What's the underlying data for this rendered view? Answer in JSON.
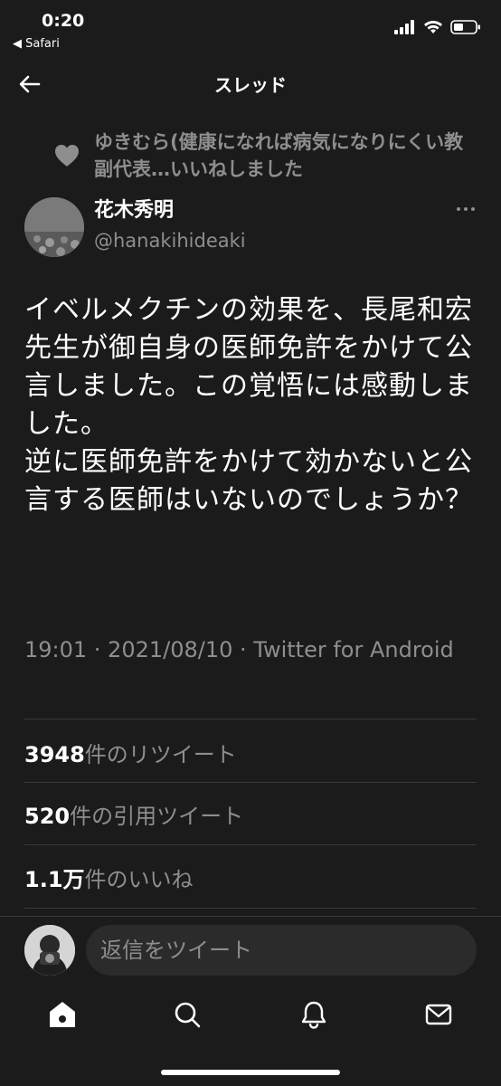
{
  "status_bar": {
    "time": "0:20",
    "back_app": "◀ Safari"
  },
  "header": {
    "title": "スレッド"
  },
  "social_context": {
    "text": "ゆきむら(健康になれば病気になりにくい教副代表…いいねしました"
  },
  "author": {
    "name": "花木秀明",
    "handle": "@hanakihideaki"
  },
  "tweet": {
    "text": "イベルメクチンの効果を、長尾和宏先生が御自身の医師免許をかけて公言しました。この覚悟には感動しました。\n逆に医師免許をかけて効かないと公言する医師はいないのでしょうか？",
    "meta": "19:01 · 2021/08/10 · Twitter for Android"
  },
  "stats": {
    "retweets_num": "3948",
    "retweets_label": "件のリツイート",
    "quotes_num": "520",
    "quotes_label": "件の引用ツイート",
    "likes_num": "1.1万",
    "likes_label": "件のいいね"
  },
  "reply": {
    "placeholder": "返信をツイート"
  },
  "tabs": {
    "icons": [
      "home-icon",
      "search-icon",
      "notifications-icon",
      "messages-icon"
    ]
  },
  "colors": {
    "background": "#1b1b1b",
    "text_primary": "#ffffff",
    "text_secondary": "#8e8e8e",
    "divider": "#3a3a3a"
  }
}
